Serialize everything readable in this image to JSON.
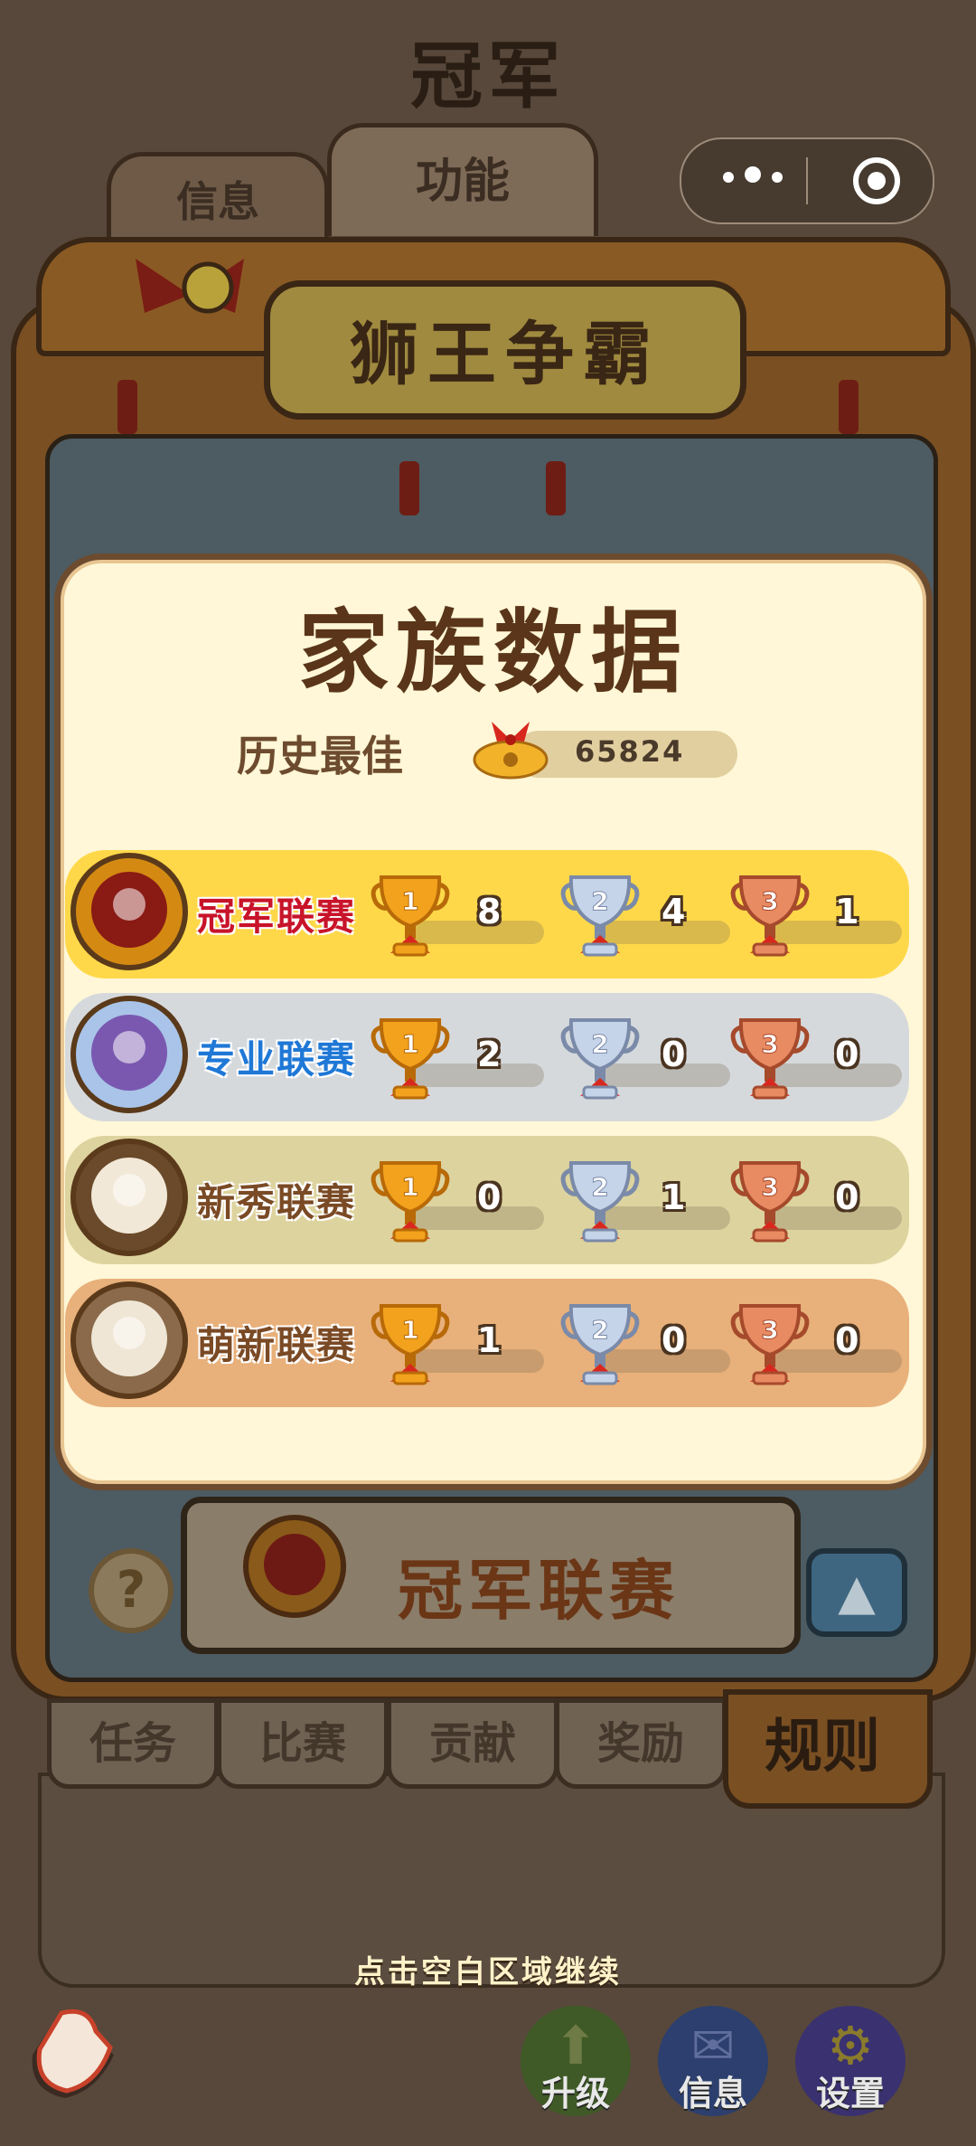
{
  "page": {
    "title": "冠军"
  },
  "tabs_top": [
    {
      "label": "信息"
    },
    {
      "label": "功能"
    }
  ],
  "banner": {
    "title": "狮王争霸"
  },
  "popup": {
    "title": "家族数据",
    "best": {
      "label": "历史最佳",
      "value": "65824"
    },
    "leagues": [
      {
        "name": "冠军联赛",
        "name_color": "#c8142a",
        "row_color": "#ffd84a",
        "gold": "8",
        "silver": "4",
        "bronze": "1"
      },
      {
        "name": "专业联赛",
        "name_color": "#1f78d6",
        "row_color": "#d6d9dc",
        "gold": "2",
        "silver": "0",
        "bronze": "0"
      },
      {
        "name": "新秀联赛",
        "name_color": "#7a4a25",
        "row_color": "#ddd39e",
        "gold": "0",
        "silver": "1",
        "bronze": "0"
      },
      {
        "name": "萌新联赛",
        "name_color": "#7a4a25",
        "row_color": "#e8b07a",
        "gold": "1",
        "silver": "0",
        "bronze": "0"
      }
    ]
  },
  "background": {
    "current_league": "冠军联赛",
    "help_icon": "?",
    "up_icon": "up-arrow-icon",
    "tabs_bottom": [
      {
        "label": "任务"
      },
      {
        "label": "比赛"
      },
      {
        "label": "贡献"
      },
      {
        "label": "奖励"
      },
      {
        "label": "规则"
      }
    ]
  },
  "hint": "点击空白区域继续",
  "nav": [
    {
      "label": "升级",
      "icon": "mushroom-icon",
      "color": "#3f5a26"
    },
    {
      "label": "信息",
      "icon": "chat-icon",
      "color": "#2c3f6e"
    },
    {
      "label": "设置",
      "icon": "gear-icon",
      "color": "#3a3170"
    }
  ]
}
